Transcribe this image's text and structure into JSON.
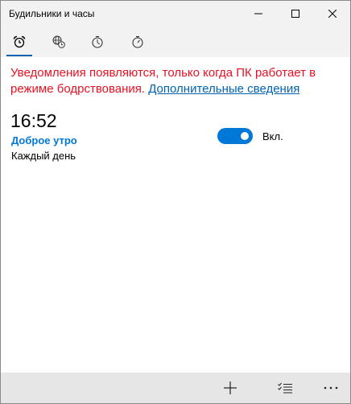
{
  "window": {
    "title": "Будильники и часы"
  },
  "tabs": [
    {
      "icon": "alarm-clock-icon",
      "selected": true
    },
    {
      "icon": "world-clock-icon",
      "selected": false
    },
    {
      "icon": "timer-icon",
      "selected": false
    },
    {
      "icon": "stopwatch-icon",
      "selected": false
    }
  ],
  "notice": {
    "text": "Уведомления появляются, только когда ПК работает в режиме бодрствования.",
    "link": "Дополнительные сведения"
  },
  "alarm": {
    "time": "16:52",
    "name": "Доброе утро",
    "repeat": "Каждый день",
    "toggle_label": "Вкл.",
    "enabled": true
  },
  "commands": {
    "add_icon": "plus-icon",
    "select_icon": "select-list-icon",
    "more_icon": "more-icon"
  },
  "colors": {
    "accent": "#0078d7",
    "warning": "#e81123",
    "link": "#0063b1",
    "chrome": "#f2f2f2",
    "command_bar": "#e6e6e6"
  }
}
